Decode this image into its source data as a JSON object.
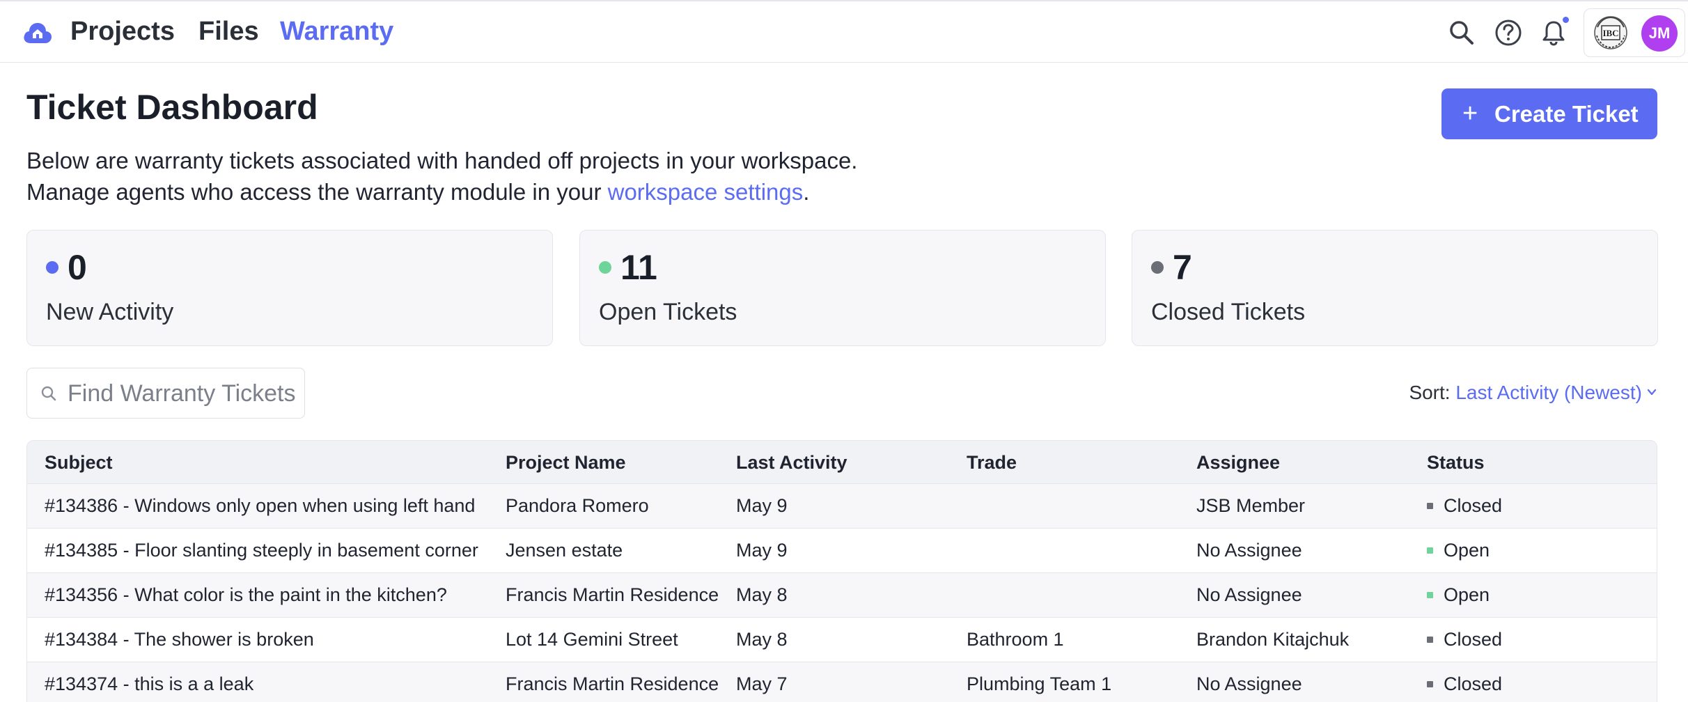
{
  "nav": {
    "items": [
      {
        "label": "Projects"
      },
      {
        "label": "Files"
      },
      {
        "label": "Warranty"
      }
    ],
    "avatar_initials": "JM",
    "company_logo_text": "IBC"
  },
  "header": {
    "title": "Ticket Dashboard",
    "create_button": "Create Ticket",
    "create_icon": "+"
  },
  "description": {
    "line1": "Below are warranty tickets associated with handed off projects in your workspace.",
    "line2_prefix": "Manage agents who access the warranty module in your ",
    "line2_link": "workspace settings",
    "line2_suffix": "."
  },
  "stats": [
    {
      "value": "0",
      "label": "New Activity",
      "color": "#5b6cf2"
    },
    {
      "value": "11",
      "label": "Open Tickets",
      "color": "#6fd49a"
    },
    {
      "value": "7",
      "label": "Closed Tickets",
      "color": "#6b6e75"
    }
  ],
  "search": {
    "placeholder": "Find Warranty Tickets"
  },
  "sort": {
    "label": "Sort: ",
    "value": "Last Activity (Newest)"
  },
  "table": {
    "columns": [
      "Subject",
      "Project Name",
      "Last Activity",
      "Trade",
      "Assignee",
      "Status"
    ],
    "rows": [
      {
        "subject": "#134386 - Windows only open when using left hand",
        "project": "Pandora Romero",
        "last_activity": "May 9",
        "trade": "",
        "assignee": "JSB Member",
        "status": "Closed"
      },
      {
        "subject": "#134385 - Floor slanting steeply in basement corner",
        "project": "Jensen estate",
        "last_activity": "May 9",
        "trade": "",
        "assignee": "No Assignee",
        "status": "Open"
      },
      {
        "subject": "#134356 - What color is the paint in the kitchen?",
        "project": "Francis Martin Residence",
        "last_activity": "May 8",
        "trade": "",
        "assignee": "No Assignee",
        "status": "Open"
      },
      {
        "subject": "#134384 - The shower is broken",
        "project": "Lot 14 Gemini Street",
        "last_activity": "May 8",
        "trade": "Bathroom 1",
        "assignee": "Brandon Kitajchuk",
        "status": "Closed"
      },
      {
        "subject": "#134374 - this is a a leak",
        "project": "Francis Martin Residence",
        "last_activity": "May 7",
        "trade": "Plumbing Team 1",
        "assignee": "No Assignee",
        "status": "Closed"
      }
    ]
  },
  "colors": {
    "accent": "#5b6cf2",
    "open": "#6fd49a",
    "closed": "#6b6e75",
    "avatar": "#b03ff0"
  },
  "icons": [
    "home-cloud-logo-icon",
    "search-icon",
    "help-circle-icon",
    "bell-icon",
    "magnifier-icon",
    "chevron-down-icon"
  ]
}
